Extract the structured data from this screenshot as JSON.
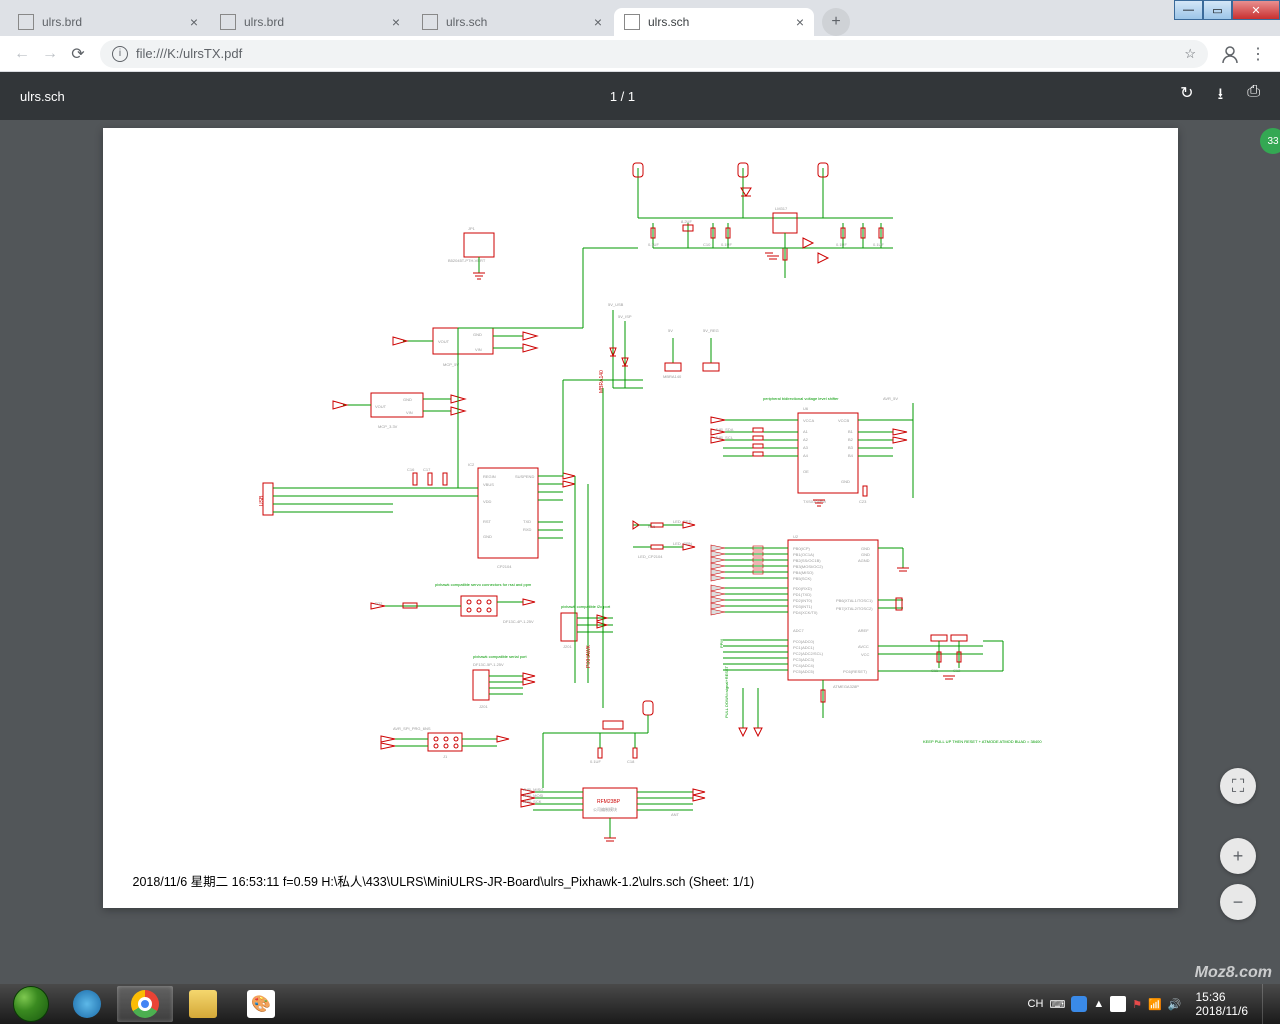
{
  "window": {
    "min": "—",
    "max": "▭",
    "close": "✕"
  },
  "tabs": [
    {
      "title": "ulrs.brd",
      "active": false
    },
    {
      "title": "ulrs.brd",
      "active": false
    },
    {
      "title": "ulrs.sch",
      "active": false
    },
    {
      "title": "ulrs.sch",
      "active": true
    }
  ],
  "new_tab": "+",
  "toolbar": {
    "back": "←",
    "fwd": "→",
    "reload": "⟳",
    "info": "i",
    "url": "file:///K:/ulrsTX.pdf",
    "star": "☆",
    "user": "◯",
    "menu": "⋮"
  },
  "pdf": {
    "title": "ulrs.sch",
    "page": "1 / 1",
    "rotate": "↻",
    "download": "⭳",
    "print": "⎙"
  },
  "schematic": {
    "blocks": {
      "jp1": "JP1",
      "b0205t": "B52045T-PTH-VERT",
      "mcp5v": "MCP_5V",
      "mcp33v": "MCP_3.3V",
      "vout1": "VOUT",
      "gnd_label": "GND",
      "vin": "VIN",
      "lm317": "LM317",
      "c10": "C10",
      "c1": "0.1UF",
      "c8": "8.2UF",
      "usb": "USB",
      "ic2": "IC2",
      "cp2104": "CP2104",
      "regin": "REGIN",
      "vbus": "VBUS",
      "suspend": "SUSPEND",
      "gnd": "GND",
      "txd": "TXD",
      "rxd": "RXD",
      "vdd": "VDD",
      "rst": "RST",
      "5v_usb": "5V_USB",
      "5v_isp": "5V_ISP",
      "5v": "5V",
      "5v_reg": "5V_REG",
      "mbra140": "MBRA140",
      "servo_note": "pixhawk compatible servo connectors\nfor rssi and ppm",
      "df13c4p": "DF13C-4P-1.25V",
      "i2c_note": "pixhawk compatible i2c port",
      "serial_note": "pixhawk compatible serial port",
      "df13c5p": "DF13C-5P-1.25V",
      "avr_spi": "AVR_SPI_PRG_6NS",
      "j1": "J1",
      "j201": "J201",
      "shifter_note": "peripheral bidirectional voltage level shifter",
      "u6": "U6",
      "vcca": "VCCA",
      "vccb": "VCCB",
      "oe": "OE",
      "txs0104": "TXS0104PW",
      "avr_5v": "AVR_5V",
      "avr_scl": "AVR_SCL",
      "avr_sda": "AVR_SDA",
      "atmega": "ATMEGA328P",
      "u2": "U2",
      "pb0": "PB0(ICP)",
      "pb1": "PB1(OC1A)",
      "pb2": "PB2(SS/OC1B)",
      "pb3": "PB3(MOSI/OC2)",
      "pb4": "PB4(MISO)",
      "pb5": "PB5(SCK)",
      "pb6": "PB6(XTAL1/TOSC1)",
      "pb7": "PB7(XTAL2/TOSC2)",
      "pd0": "PD0(RXD)",
      "pd1": "PD1(TXD)",
      "pd2": "PD2(INT0)",
      "pc0": "PC0(ADC0)",
      "pc1": "PC1(ADC1)",
      "pc2": "PC2(ADC2/SCL)",
      "pc3": "PC3(ADC3)",
      "pc4": "PC4(ADC4)",
      "pc5": "PC5(ADC5)",
      "pc6": "PC6(RESET)",
      "adc6": "ADC6",
      "adc7": "ADC7",
      "aref": "AREF",
      "avcc": "AVCC",
      "agnd": "AGND",
      "vcc": "VCC",
      "gnd2": "GND",
      "r15": "R15",
      "led_red": "LED_RED",
      "led_cp": "LED_CP2104",
      "led_grn": "LED_GRN",
      "ppm": "PPM",
      "c11": "C11",
      "c12": "C12",
      "pull_note": "KEEP PULL UP THEN RESET + ATMODE\nATMOD BUAD = 38400",
      "pulldown": "PULL DOWN=signal+RESET",
      "rfm23bp": "RFM23BP",
      "module": "公司编制模块",
      "ant": "ANT",
      "miso": "AVR_MISO",
      "mosi": "AVR_MOSI",
      "sck": "AVR_SCK",
      "c22": "C23",
      "r22": "R22"
    },
    "caption": "2018/11/6 星期二 16:53:11  f=0.59  H:\\私人\\433\\ULRS\\MiniULRS-JR-Board\\ulrs_Pixhawk-1.2\\ulrs.sch (Sheet: 1/1)"
  },
  "controls": {
    "fit": "⛶",
    "plus": "+",
    "minus": "−"
  },
  "badge": "33",
  "tray": {
    "ime": "CH",
    "kbd": "⌨",
    "up": "▲",
    "t1": "15:36",
    "date": "2018/11/6"
  },
  "watermark": "Moz8.com"
}
